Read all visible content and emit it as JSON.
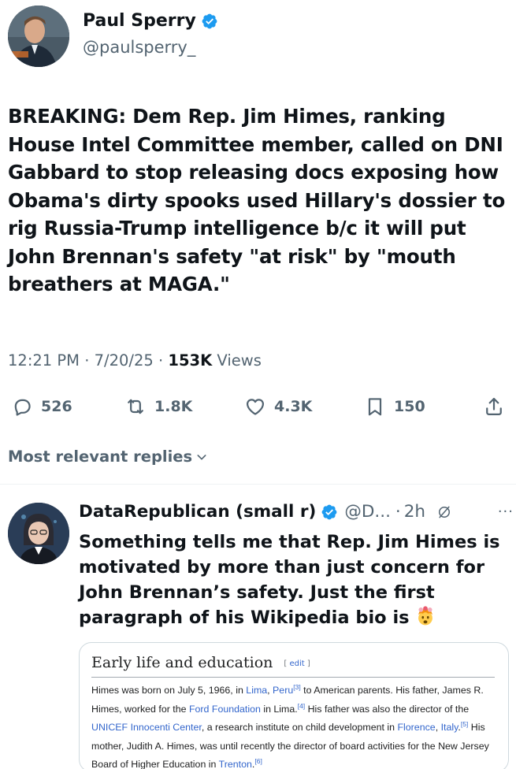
{
  "tweet": {
    "author_name": "Paul Sperry",
    "author_handle": "@paulsperry_",
    "text": "BREAKING: Dem Rep. Jim Himes, ranking House Intel Committee member, called on DNI Gabbard to stop releasing docs exposing how Obama's dirty spooks used Hillary's dossier to rig Russia-Trump intelligence b/c it will put John Brennan's safety \"at risk\" by \"mouth breathers at MAGA.\"",
    "time": "12:21 PM",
    "date": "7/20/25",
    "views_count": "153K",
    "views_label": "Views",
    "separator": "·",
    "actions": {
      "replies": "526",
      "reposts": "1.8K",
      "likes": "4.3K",
      "bookmarks": "150"
    }
  },
  "replies_sort_label": "Most relevant replies",
  "reply": {
    "author_name": "DataRepublican (small r)",
    "author_handle": "@D...",
    "separator": "·",
    "time": "2h",
    "more": "···",
    "text": "Something tells me that Rep. Jim Himes is motivated by more than just concern for John Brennan’s safety. Just the first paragraph of his Wikipedia bio is",
    "emoji": "exploding-head-emoji"
  },
  "wiki": {
    "heading": "Early life and education",
    "edit_open": "[ ",
    "edit_label": "edit",
    "edit_close": " ]",
    "t1": "Himes was born on July 5, 1966, in ",
    "l1": "Lima",
    "t2": ", ",
    "l2": "Peru",
    "r1": "[3]",
    "t3": " to American parents. His father, James R. Himes, worked for the ",
    "l3": "Ford Foundation",
    "t4": " in Lima.",
    "r2": "[4]",
    "t5": " His father was also the director of the ",
    "l4": "UNICEF Innocenti Center",
    "t6": ", a research institute on child development in ",
    "l5": "Florence",
    "t7": ", ",
    "l6": "Italy",
    "t8": ".",
    "r3": "[5]",
    "t9": " His mother, Judith A. Himes, was until recently the director of board activities for the New Jersey Board of Higher Education in ",
    "l7": "Trenton",
    "t10": ".",
    "r4": "[6]"
  },
  "colors": {
    "text": "#0f1419",
    "secondary": "#536471",
    "verified": "#1d9bf0",
    "wiki_link": "#3366cc"
  }
}
